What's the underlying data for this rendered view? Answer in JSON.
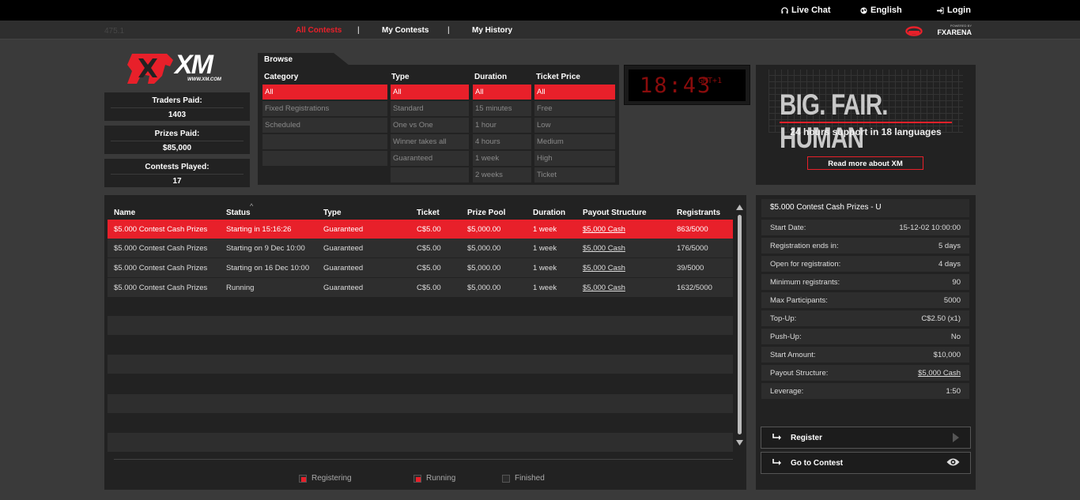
{
  "topbar": {
    "live_chat": "Live Chat",
    "language": "English",
    "login": "Login"
  },
  "nav": {
    "faded_id": "475.1",
    "tabs": [
      {
        "label": "All Contests"
      },
      {
        "label": "My Contests"
      },
      {
        "label": "My History"
      }
    ],
    "separator": "|",
    "powered_by": "POWERED BY",
    "partner": "FXARENA"
  },
  "logo": {
    "text": "XM",
    "url_text": "WWW.XM.COM"
  },
  "stats": [
    {
      "label": "Traders Paid:",
      "value": "1403"
    },
    {
      "label": "Prizes Paid:",
      "value": "$85,000"
    },
    {
      "label": "Contests Played:",
      "value": "17"
    }
  ],
  "browse": {
    "title": "Browse",
    "columns": [
      {
        "header": "Category",
        "options": [
          "All",
          "Fixed Registrations",
          "Scheduled",
          "",
          ""
        ],
        "selected": 0
      },
      {
        "header": "Type",
        "options": [
          "All",
          "Standard",
          "One vs One",
          "Winner takes all",
          "Guaranteed",
          ""
        ],
        "selected": 0
      },
      {
        "header": "Duration",
        "options": [
          "All",
          "15 minutes",
          "1 hour",
          "4 hours",
          "1 week",
          "2 weeks"
        ],
        "selected": 0
      },
      {
        "header": "Ticket Price",
        "options": [
          "All",
          "Free",
          "Low",
          "Medium",
          "High",
          "Ticket"
        ],
        "selected": 0
      }
    ]
  },
  "clock": {
    "time": "18:43",
    "zone": "GMT+1"
  },
  "ad": {
    "headline": "BIG. FAIR. HUMAN",
    "subline": "24 hours support in 18 languages",
    "button": "Read more about XM"
  },
  "table": {
    "columns": [
      "Name",
      "Status",
      "Type",
      "Ticket",
      "Prize Pool",
      "Duration",
      "Payout Structure",
      "Registrants"
    ],
    "rows": [
      {
        "name": "$5.000 Contest Cash Prizes",
        "status": "Starting in 15:16:26",
        "type": "Guaranteed",
        "ticket": "C$5.00",
        "prize": "$5,000.00",
        "duration": "1 week",
        "payout": "$5,000 Cash",
        "registrants": "863/5000",
        "selected": true
      },
      {
        "name": "$5.000 Contest Cash Prizes",
        "status": "Starting on 9 Dec 10:00",
        "type": "Guaranteed",
        "ticket": "C$5.00",
        "prize": "$5,000.00",
        "duration": "1 week",
        "payout": "$5,000 Cash",
        "registrants": "176/5000",
        "selected": false
      },
      {
        "name": "$5.000 Contest Cash Prizes",
        "status": "Starting on 16 Dec 10:00",
        "type": "Guaranteed",
        "ticket": "C$5.00",
        "prize": "$5,000.00",
        "duration": "1 week",
        "payout": "$5,000 Cash",
        "registrants": "39/5000",
        "selected": false
      },
      {
        "name": "$5.000 Contest Cash Prizes",
        "status": "Running",
        "type": "Guaranteed",
        "ticket": "C$5.00",
        "prize": "$5,000.00",
        "duration": "1 week",
        "payout": "$5,000 Cash",
        "registrants": "1632/5000",
        "selected": false
      }
    ],
    "legend": [
      {
        "label": "Registering",
        "active": true
      },
      {
        "label": "Running",
        "active": true
      },
      {
        "label": "Finished",
        "active": false
      }
    ]
  },
  "detail": {
    "title": "$5.000 Contest Cash Prizes - U",
    "rows": [
      {
        "key": "Start Date:",
        "value": "15-12-02 10:00:00"
      },
      {
        "key": "Registration ends in:",
        "value": "5 days"
      },
      {
        "key": "Open for registration:",
        "value": "4 days"
      },
      {
        "key": "Minimum registrants:",
        "value": "90"
      },
      {
        "key": "Max Participants:",
        "value": "5000"
      },
      {
        "key": "Top-Up:",
        "value": "C$2.50 (x1)"
      },
      {
        "key": "Push-Up:",
        "value": "No"
      },
      {
        "key": "Start Amount:",
        "value": "$10,000"
      },
      {
        "key": "Payout Structure:",
        "value": "$5,000 Cash"
      },
      {
        "key": "Leverage:",
        "value": "1:50"
      }
    ],
    "register_button": "Register",
    "goto_button": "Go to Contest"
  },
  "colors": {
    "accent": "#e8202a",
    "panel": "#222222",
    "background": "#3a3a3a"
  }
}
